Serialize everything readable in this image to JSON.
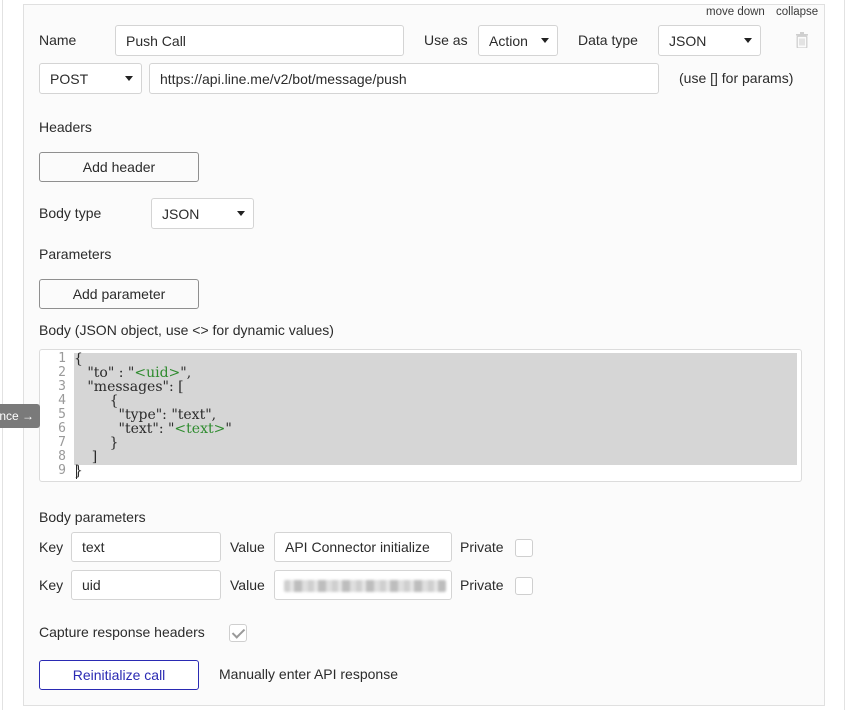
{
  "header": {
    "move_down": "move down",
    "collapse": "collapse"
  },
  "name_row": {
    "name_label": "Name",
    "name_value": "Push Call",
    "use_as_label": "Use as",
    "use_as_value": "Action",
    "data_type_label": "Data type",
    "data_type_value": "JSON",
    "delete_icon": "trash-icon"
  },
  "request_row": {
    "method": "POST",
    "url": "https://api.line.me/v2/bot/message/push",
    "hint": "(use [] for params)"
  },
  "headers_section": {
    "title": "Headers",
    "add_button": "Add header"
  },
  "body_type": {
    "label": "Body type",
    "value": "JSON"
  },
  "parameters_section": {
    "title": "Parameters",
    "add_button": "Add parameter"
  },
  "body_section": {
    "label": "Body (JSON object, use <> for dynamic values)",
    "line_numbers": [
      "1",
      "2",
      "3",
      "4",
      "5",
      "6",
      "7",
      "8",
      "9"
    ]
  },
  "side_tab": {
    "label": "nce →"
  },
  "body_parameters": {
    "title": "Body parameters",
    "key_label": "Key",
    "value_label": "Value",
    "private_label": "Private",
    "rows": [
      {
        "key": "text",
        "value": "API Connector initialize",
        "private": false
      },
      {
        "key": "uid",
        "value": "",
        "private": false
      }
    ]
  },
  "capture": {
    "label": "Capture response headers",
    "checked": true
  },
  "actions": {
    "reinitialize": "Reinitialize call",
    "manual": "Manually enter API response"
  }
}
